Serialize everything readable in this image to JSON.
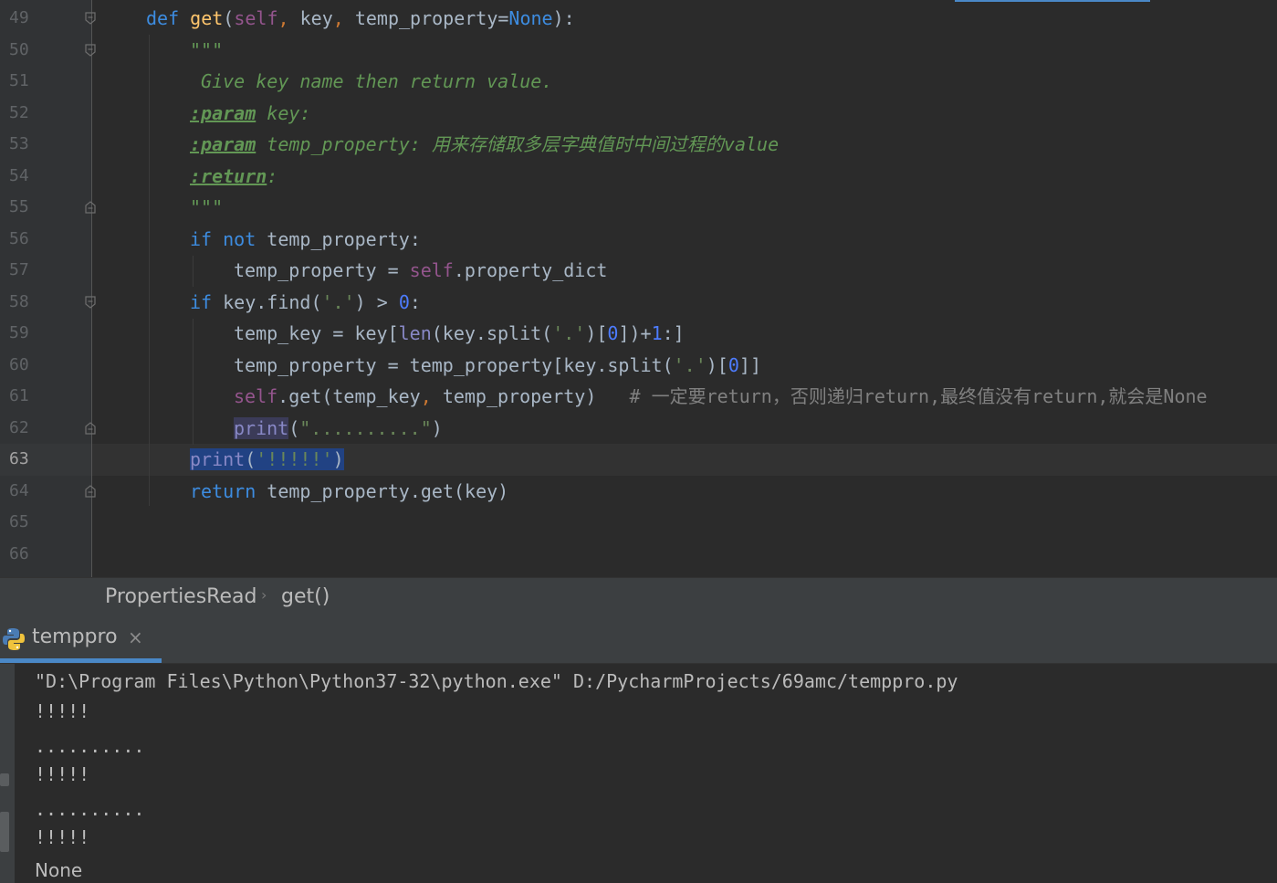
{
  "editor": {
    "line_numbers": [
      "49",
      "50",
      "51",
      "52",
      "53",
      "54",
      "55",
      "56",
      "57",
      "58",
      "59",
      "60",
      "61",
      "62",
      "63",
      "64",
      "65",
      "66"
    ],
    "current_line": "63",
    "lines": {
      "l49": {
        "def": "def",
        "name": "get",
        "open": "(",
        "self": "self",
        "c1": ", ",
        "p1": "key",
        "c2": ", ",
        "p2": "temp_property",
        "eq": "=",
        "none": "None",
        "close": "):"
      },
      "l50": {
        "q": "\"\"\""
      },
      "l51": {
        "text": " Give key name then return value."
      },
      "l52": {
        "tag": ":param",
        "rest": " key:"
      },
      "l53": {
        "tag": ":param",
        "rest": " temp_property: 用来存储取多层字典值时中间过程的value"
      },
      "l54": {
        "tag": ":return",
        "rest": ":"
      },
      "l55": {
        "q": "\"\"\""
      },
      "l56": {
        "if": "if",
        "not": "not",
        "rest": " temp_property:"
      },
      "l57": {
        "a": "temp_property = ",
        "self": "self",
        "b": ".property_dict"
      },
      "l58": {
        "if": "if",
        "a": " key.find(",
        "s": "'.'",
        "b": ") > ",
        "n": "0",
        "c": ":"
      },
      "l59": {
        "a": "temp_key = key[",
        "len": "len",
        "b": "(key.split(",
        "s": "'.'",
        "c": ")[",
        "n0": "0",
        "d": "])+",
        "n1": "1",
        "e": ":]"
      },
      "l60": {
        "a": "temp_property = temp_property[key.split(",
        "s": "'.'",
        "b": ")[",
        "n0": "0",
        "c": "]]"
      },
      "l61": {
        "self": "self",
        "a": ".get(temp_key",
        "c": ", ",
        "b": "temp_property)",
        "cm": "# 一定要return，否则递归return,最终值没有return,就会是None"
      },
      "l62": {
        "print": "print",
        "a": "(",
        "s": "\"..........\"",
        "b": ")"
      },
      "l63": {
        "print": "print",
        "a": "(",
        "s": "'!!!!!'",
        "b": ")"
      },
      "l64": {
        "ret": "return",
        "a": " temp_property.get(key)"
      }
    }
  },
  "breadcrumb": {
    "class_name": "PropertiesRead",
    "method": "get()"
  },
  "run_panel": {
    "tab_label": "temppro",
    "close": "×"
  },
  "console": {
    "lines": [
      "\"D:\\Program Files\\Python\\Python37-32\\python.exe\" D:/PycharmProjects/69amc/temppro.py",
      "!!!!!",
      "..........",
      "!!!!!",
      "..........",
      "!!!!!",
      "None"
    ]
  },
  "colors": {
    "background": "#2b2b2b",
    "keyword": "#cc7832",
    "number": "#4d7cff",
    "string": "#6a8759",
    "selection": "#214283"
  }
}
